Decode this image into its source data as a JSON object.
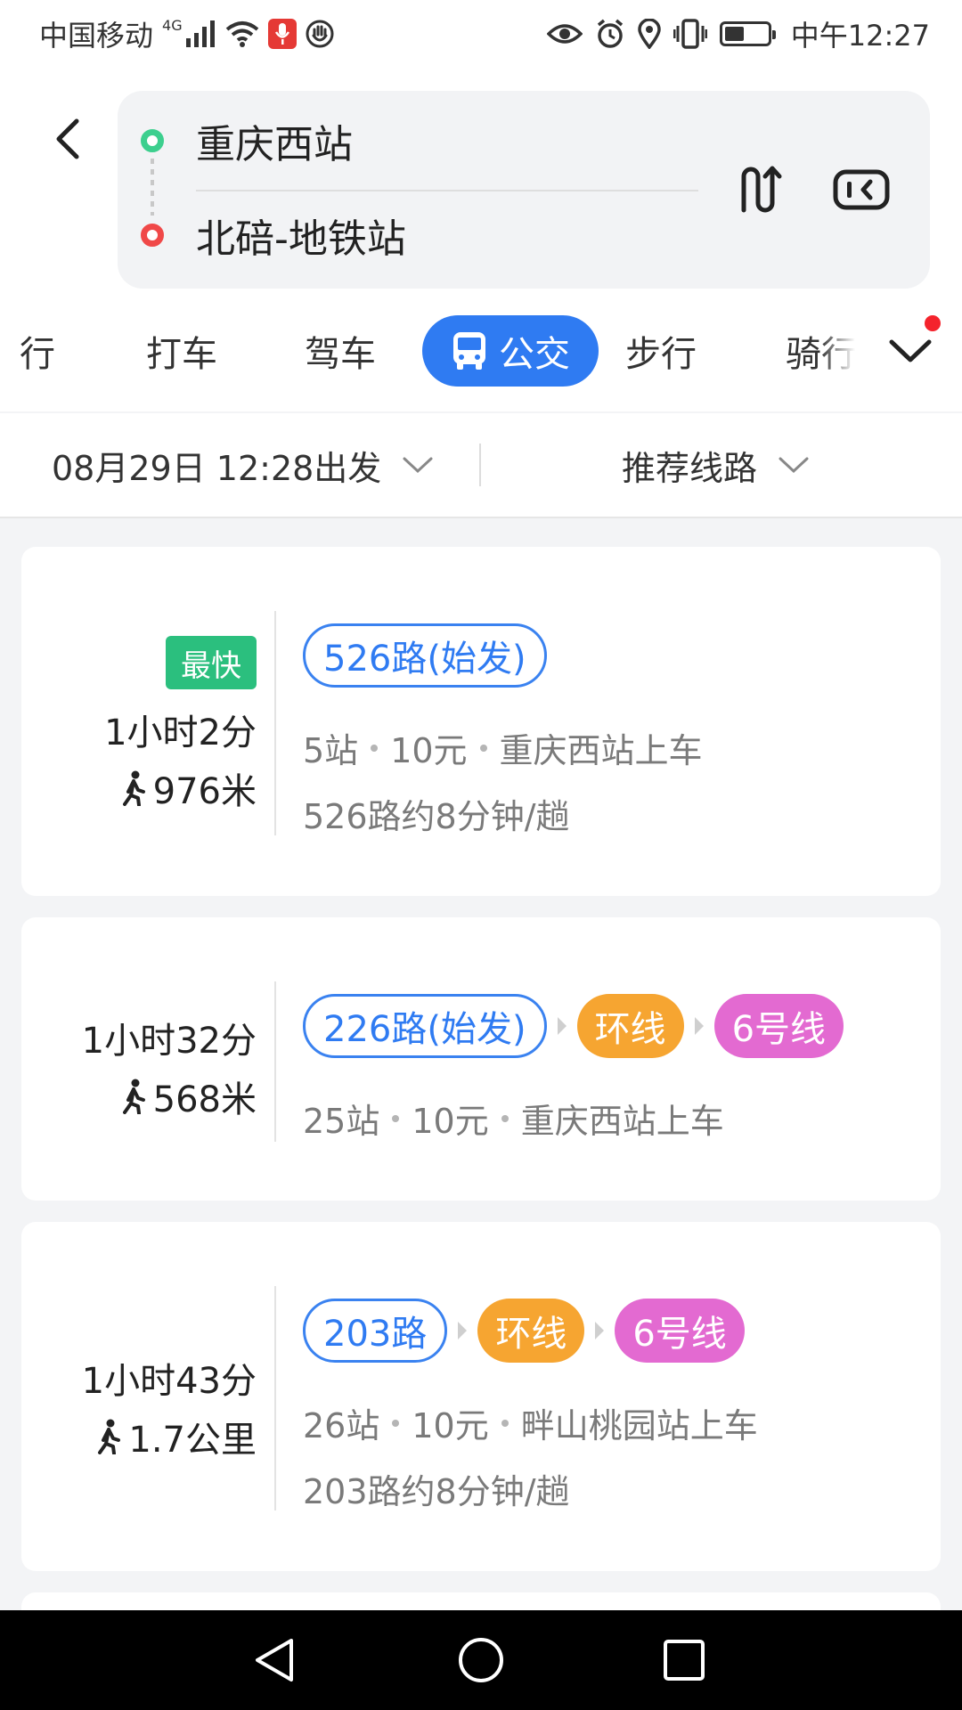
{
  "status_bar": {
    "carrier": "中国移动",
    "network": "4G",
    "time": "中午12:27"
  },
  "header": {
    "origin": "重庆西站",
    "destination": "北碚-地铁站"
  },
  "tabs": [
    {
      "label": "行"
    },
    {
      "label": "打车"
    },
    {
      "label": "驾车"
    },
    {
      "label": "公交",
      "active": true
    },
    {
      "label": "步行"
    },
    {
      "label": "骑行"
    }
  ],
  "filters": {
    "departure": "08月29日 12:28出发",
    "sort": "推荐线路"
  },
  "routes": [
    {
      "badge": "最快",
      "duration": "1小时2分",
      "walk": "976米",
      "lines": [
        {
          "label": "526路(始发)",
          "kind": "bus"
        }
      ],
      "stops": "5站",
      "fare": "10元",
      "board": "重庆西站上车",
      "frequency": "526路约8分钟/趟"
    },
    {
      "duration": "1小时32分",
      "walk": "568米",
      "lines": [
        {
          "label": "226路(始发)",
          "kind": "bus"
        },
        {
          "label": "环线",
          "kind": "metro",
          "color": "#f6a531"
        },
        {
          "label": "6号线",
          "kind": "metro",
          "color": "#e36ad1"
        }
      ],
      "stops": "25站",
      "fare": "10元",
      "board": "重庆西站上车"
    },
    {
      "duration": "1小时43分",
      "walk": "1.7公里",
      "lines": [
        {
          "label": "203路",
          "kind": "bus"
        },
        {
          "label": "环线",
          "kind": "metro",
          "color": "#f6a531"
        },
        {
          "label": "6号线",
          "kind": "metro",
          "color": "#e36ad1"
        }
      ],
      "stops": "26站",
      "fare": "10元",
      "board": "畔山桃园站上车",
      "frequency": "203路约8分钟/趟"
    }
  ],
  "colors": {
    "accent": "#2f7bf2",
    "fast_badge": "#2bbf7e",
    "origin_dot": "#3ccf8e",
    "destination_dot": "#f04848"
  }
}
